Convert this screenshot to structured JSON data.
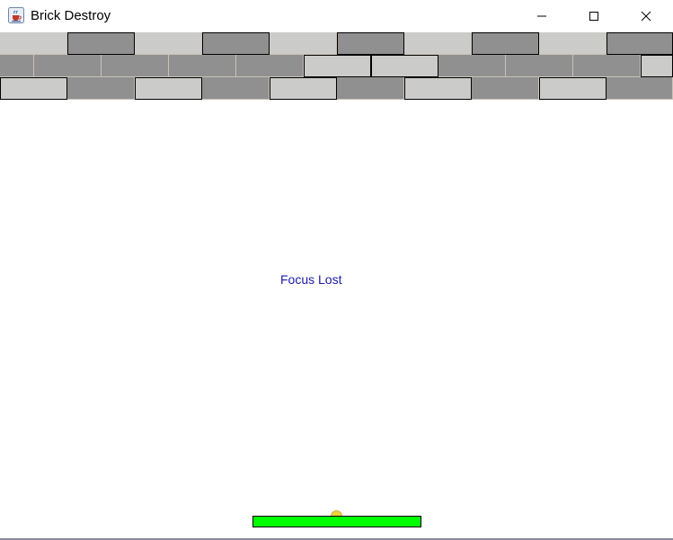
{
  "window": {
    "title": "Brick Destroy",
    "icon": "java-cup-icon",
    "controls": [
      "minimize-icon",
      "maximize-icon",
      "close-icon"
    ]
  },
  "game": {
    "message": "Focus Lost",
    "colors": {
      "background": "#ffffff",
      "brick_light": "#cbcbc9",
      "brick_dark": "#909090",
      "paddle": "#00ff00",
      "ball": "#f2d33a",
      "message": "#1a1aa8"
    },
    "brick_rows": [
      [
        "light",
        "dark",
        "light",
        "dark",
        "light",
        "dark",
        "light",
        "dark",
        "light",
        "dark"
      ],
      [
        "dark",
        "dark",
        "dark",
        "dark",
        "dark",
        "light",
        "light",
        "dark",
        "dark",
        "dark",
        "light"
      ],
      [
        "light",
        "dark",
        "light",
        "dark",
        "light",
        "dark",
        "light",
        "dark",
        "light",
        "dark"
      ]
    ]
  }
}
